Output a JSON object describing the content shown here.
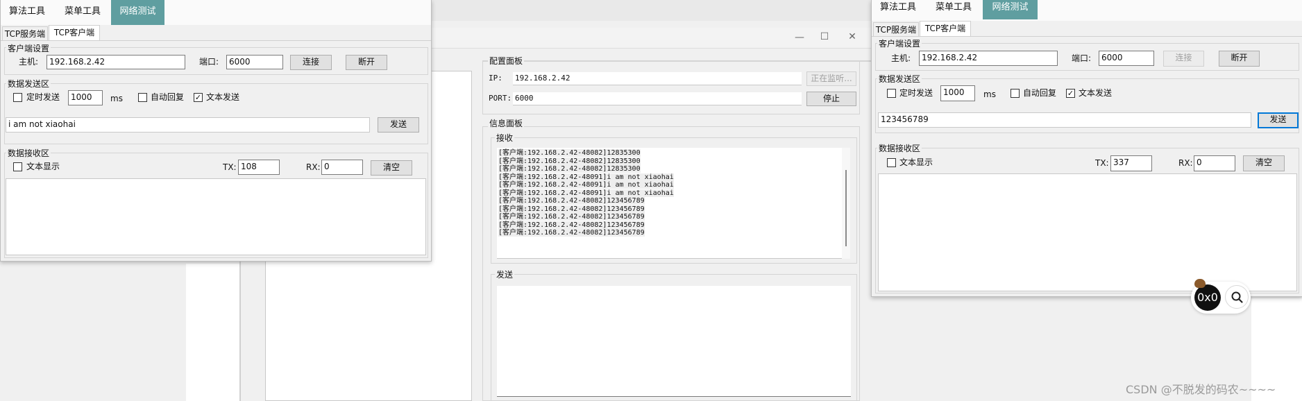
{
  "colors": {
    "accent_tab": "#5f9ea0",
    "focus": "#0078d7"
  },
  "menu_left": [
    {
      "label": "算法工具"
    },
    {
      "label": "菜单工具"
    },
    {
      "label": "网络测试"
    }
  ],
  "menu_right": [
    {
      "label": "算法工具"
    },
    {
      "label": "菜单工具"
    },
    {
      "label": "网络测试"
    }
  ],
  "tabs": {
    "server": "TCP服务端",
    "client": "TCP客户端"
  },
  "client_left": {
    "settings_title": "客户端设置",
    "host_label": "主机:",
    "host_value": "192.168.2.42",
    "port_label": "端口:",
    "port_value": "6000",
    "connect_button": "连接",
    "disconnect_button": "断开",
    "send_group_title": "数据发送区",
    "timed_send_label": "定时发送",
    "interval_value": "1000",
    "interval_unit": "ms",
    "auto_reply_label": "自动回复",
    "text_send_label": "文本发送",
    "send_text": "i am not xiaohai",
    "send_button": "发送",
    "recv_group_title": "数据接收区",
    "text_display_label": "文本显示",
    "tx_label": "TX:",
    "tx_value": "108",
    "rx_label": "RX:",
    "rx_value": "0",
    "clear_button": "清空"
  },
  "client_right": {
    "settings_title": "客户端设置",
    "host_label": "主机:",
    "host_value": "192.168.2.42",
    "port_label": "端口:",
    "port_value": "6000",
    "connect_button": "连接",
    "disconnect_button": "断开",
    "send_group_title": "数据发送区",
    "timed_send_label": "定时发送",
    "interval_value": "1000",
    "interval_unit": "ms",
    "auto_reply_label": "自动回复",
    "text_send_label": "文本发送",
    "send_text": "123456789",
    "send_button": "发送",
    "recv_group_title": "数据接收区",
    "text_display_label": "文本显示",
    "tx_label": "TX:",
    "tx_value": "337",
    "rx_label": "RX:",
    "rx_value": "0",
    "clear_button": "清空"
  },
  "server": {
    "config_title": "配置面板",
    "ip_label": "IP:",
    "ip_value": "192.168.2.42",
    "listening_button": "正在监听...",
    "port_label": "PORT:",
    "port_value": "6000",
    "stop_button": "停止",
    "info_title": "信息面板",
    "recv_title": "接收",
    "log": [
      "[客户端:192.168.2.42-48082]12835300",
      "[客户端:192.168.2.42-48082]12835300",
      "[客户端:192.168.2.42-48082]12835300",
      "[客户端:192.168.2.42-48091]i am not xiaohai",
      "[客户端:192.168.2.42-48091]i am not xiaohai",
      "[客户端:192.168.2.42-48091]i am not xiaohai",
      "[客户端:192.168.2.42-48082]123456789",
      "[客户端:192.168.2.42-48082]123456789",
      "[客户端:192.168.2.42-48082]123456789",
      "[客户端:192.168.2.42-48082]123456789",
      "[客户端:192.168.2.42-48082]123456789"
    ],
    "send_title": "发送"
  },
  "window_controls": {
    "minimize": "—",
    "maximize": "☐",
    "close": "✕"
  },
  "floating": {
    "badge": "0x0"
  },
  "watermark": "CSDN @不脱发的码农~~~~"
}
